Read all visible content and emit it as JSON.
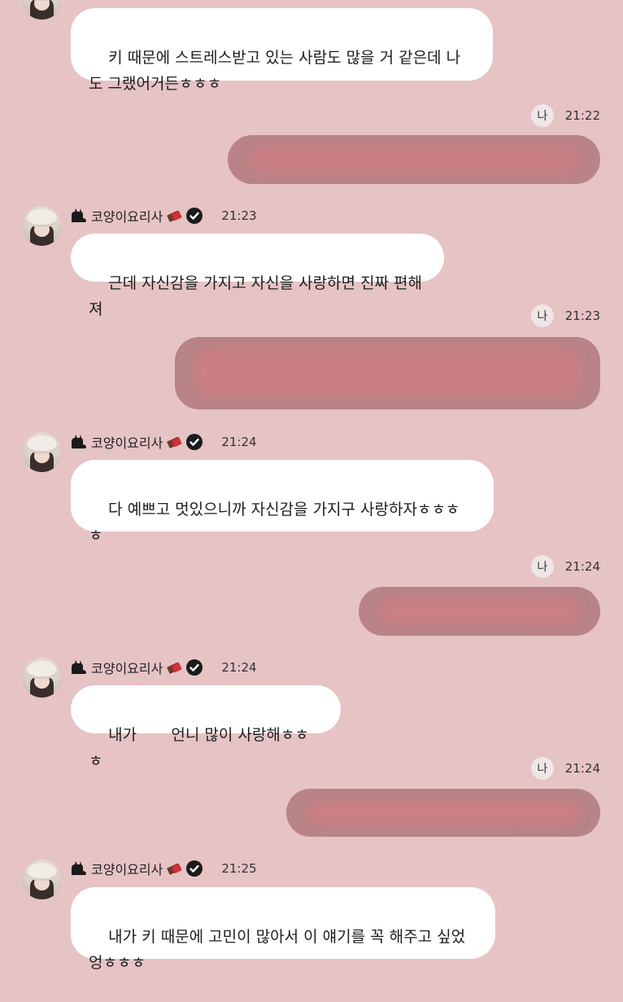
{
  "partner": {
    "display_name": "코양이요리사",
    "name_prefix_icon": "black-cat-icon",
    "name_suffix_icon": "chocolate-bar-icon",
    "verified_icon": "verified-badge-icon"
  },
  "me_label": "나",
  "colors": {
    "background": "#e6c3c5",
    "incoming_bubble": "#ffffff",
    "outgoing_bubble_redacted": "#b88488"
  },
  "messages": [
    {
      "from": "partner",
      "time": "",
      "text": "키 때문에 스트레스받고 있는 사람도 많을 거 같은데 나\n도 그랬어거든ㅎㅎㅎ"
    },
    {
      "from": "me",
      "time": "21:22",
      "text_redacted": true
    },
    {
      "from": "partner",
      "time": "21:23",
      "text": "근데 자신감을 가지고 자신을 사랑하면 진짜 편해져"
    },
    {
      "from": "me",
      "time": "21:23",
      "text_redacted": true
    },
    {
      "from": "partner",
      "time": "21:24",
      "text": "다 예쁘고 멋있으니까 자신감을 가지구 사랑하자ㅎㅎㅎ\nㅎ"
    },
    {
      "from": "me",
      "time": "21:24",
      "text_redacted": true
    },
    {
      "from": "partner",
      "time": "21:24",
      "text": "내가       언니 많이 사랑해ㅎㅎㅎ"
    },
    {
      "from": "me",
      "time": "21:24",
      "text_redacted": true
    },
    {
      "from": "partner",
      "time": "21:25",
      "text": "내가 키 때문에 고민이 많아서 이 얘기를 꼭 해주고 싶었\n엉ㅎㅎㅎ"
    }
  ]
}
